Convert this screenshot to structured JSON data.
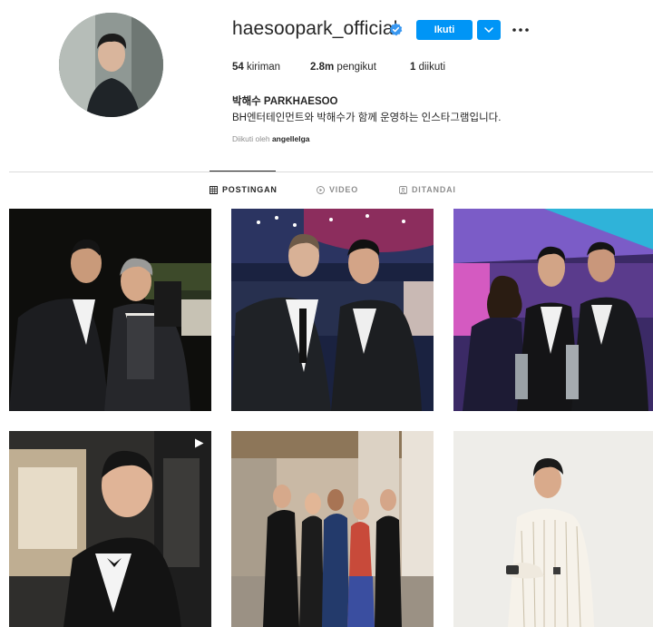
{
  "profile": {
    "username": "haesoopark_official",
    "follow_label": "Ikuti",
    "stats": {
      "posts_count": "54",
      "posts_label": "kiriman",
      "followers_count": "2.8m",
      "followers_label": "pengikut",
      "following_count": "1",
      "following_label": "diikuti"
    },
    "fullname": "박해수 PARKHAESOO",
    "bio": "BH엔터테인먼트와 박해수가 함께 운영하는 인스타그램입니다.",
    "followed_by_prefix": "Diikuti oleh",
    "followed_by_user": "angellelga"
  },
  "tabs": [
    {
      "label": "POSTINGAN",
      "icon": "grid-icon",
      "active": true
    },
    {
      "label": "VIDEO",
      "icon": "video-icon",
      "active": false
    },
    {
      "label": "DITANDAI",
      "icon": "tagged-icon",
      "active": false
    }
  ],
  "posts": [
    {
      "type": "photo",
      "icon": "none"
    },
    {
      "type": "photo",
      "icon": "none"
    },
    {
      "type": "photo",
      "icon": "none"
    },
    {
      "type": "video",
      "icon": "play-icon"
    },
    {
      "type": "photo",
      "icon": "none"
    },
    {
      "type": "photo",
      "icon": "none"
    }
  ],
  "colors": {
    "accent": "#0095f6",
    "text": "#262626",
    "muted": "#8e8e8e",
    "divider": "#dbdbdb"
  }
}
